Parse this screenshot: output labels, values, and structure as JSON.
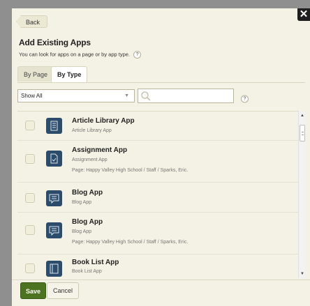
{
  "dialog": {
    "back_label": "Back",
    "close_label": "✕",
    "title": "Add Existing Apps",
    "subtitle": "You can look for apps on a page or by app type.",
    "help_glyph": "?"
  },
  "tabs": [
    {
      "label": "By Page",
      "active": false
    },
    {
      "label": "By Type",
      "active": true
    }
  ],
  "filter": {
    "select_value": "Show All",
    "search_value": "",
    "search_placeholder": ""
  },
  "apps": [
    {
      "name": "Article Library App",
      "type": "Article Library App",
      "page": "",
      "icon": "article-library-icon"
    },
    {
      "name": "Assignment App",
      "type": "Assignment App",
      "page": "Page: Happy Valley High School / Staff / Sparks, Eric.",
      "icon": "assignment-icon"
    },
    {
      "name": "Blog App",
      "type": "Blog App",
      "page": "",
      "icon": "blog-icon"
    },
    {
      "name": "Blog App",
      "type": "Blog App",
      "page": "Page: Happy Valley High School / Staff / Sparks, Eric.",
      "icon": "blog-icon"
    },
    {
      "name": "Book List App",
      "type": "Book List App",
      "page": "",
      "icon": "book-list-icon"
    }
  ],
  "footer": {
    "save_label": "Save",
    "cancel_label": "Cancel"
  },
  "colors": {
    "dialog_bg": "#f4f2e4",
    "icon_blue": "#2c4c6b",
    "save_green": "#4b7320"
  }
}
